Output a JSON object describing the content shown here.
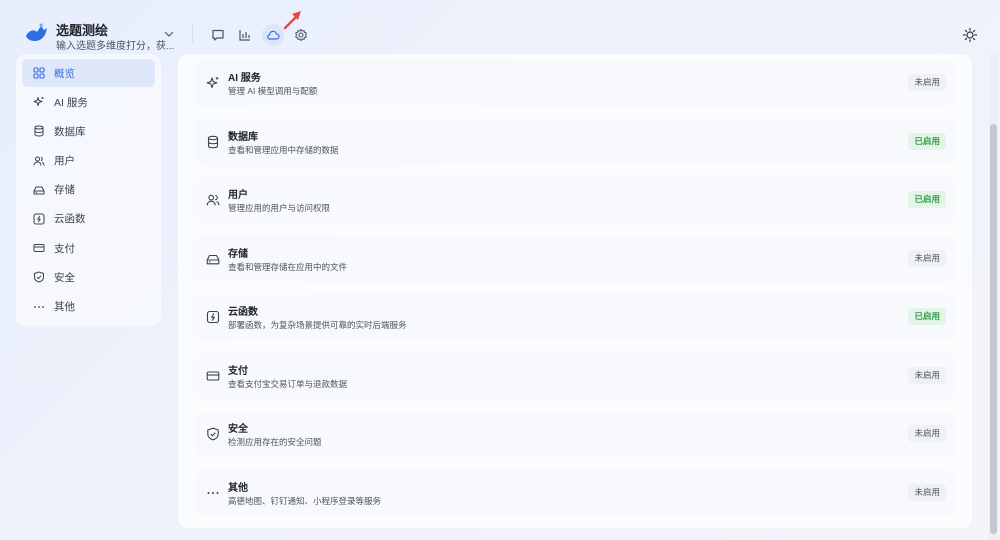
{
  "app": {
    "name": "选题测绘",
    "description": "输入选题多维度打分，获..."
  },
  "header": {
    "icons": [
      {
        "name": "chat-icon"
      },
      {
        "name": "bar-chart-icon"
      },
      {
        "name": "cloud-icon",
        "active": true
      },
      {
        "name": "settings-icon"
      }
    ],
    "theme_icon": "sun-icon"
  },
  "colors": {
    "accent": "#3b6fe0",
    "enabled_bg": "#e3f5e6",
    "enabled_text": "#2f9b47",
    "disabled_bg": "#f0f1f4"
  },
  "sidebar": {
    "items": [
      {
        "label": "概览",
        "icon": "grid-icon",
        "active": true
      },
      {
        "label": "AI 服务",
        "icon": "sparkle-icon"
      },
      {
        "label": "数据库",
        "icon": "database-icon"
      },
      {
        "label": "用户",
        "icon": "users-icon"
      },
      {
        "label": "存储",
        "icon": "storage-icon"
      },
      {
        "label": "云函数",
        "icon": "function-icon"
      },
      {
        "label": "支付",
        "icon": "card-icon"
      },
      {
        "label": "安全",
        "icon": "shield-icon"
      },
      {
        "label": "其他",
        "icon": "more-icon"
      }
    ]
  },
  "services": [
    {
      "name": "AI 服务",
      "description": "管理 AI 模型调用与配额",
      "status": "未启用",
      "enabled": false,
      "icon": "sparkle-icon"
    },
    {
      "name": "数据库",
      "description": "查看和管理应用中存储的数据",
      "status": "已启用",
      "enabled": true,
      "icon": "database-icon"
    },
    {
      "name": "用户",
      "description": "管理应用的用户与访问权限",
      "status": "已启用",
      "enabled": true,
      "icon": "users-icon"
    },
    {
      "name": "存储",
      "description": "查看和管理存储在应用中的文件",
      "status": "未启用",
      "enabled": false,
      "icon": "storage-icon"
    },
    {
      "name": "云函数",
      "description": "部署函数，为复杂场景提供可靠的实时后端服务",
      "status": "已启用",
      "enabled": true,
      "icon": "function-icon"
    },
    {
      "name": "支付",
      "description": "查看支付宝交易订单与退款数据",
      "status": "未启用",
      "enabled": false,
      "icon": "card-icon"
    },
    {
      "name": "安全",
      "description": "检测应用存在的安全问题",
      "status": "未启用",
      "enabled": false,
      "icon": "shield-icon"
    },
    {
      "name": "其他",
      "description": "高德地图、钉钉通知、小程序登录等服务",
      "status": "未启用",
      "enabled": false,
      "icon": "more-icon"
    }
  ]
}
